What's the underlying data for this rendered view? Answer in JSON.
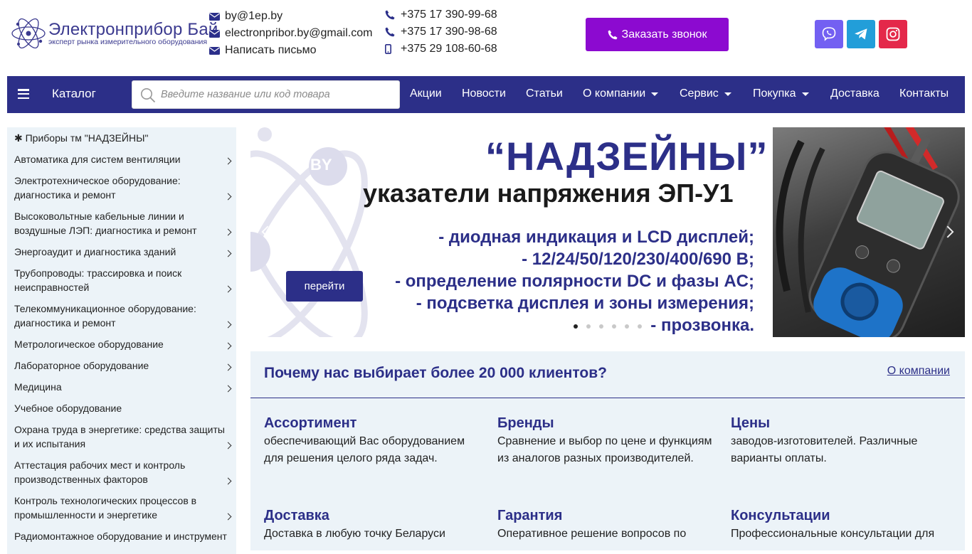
{
  "logo": {
    "name": "Электронприбор Бай",
    "tagline": "эксперт рынка измерительного оборудования"
  },
  "contacts": {
    "emails": [
      "by@1ep.by",
      "electronpribor.by@gmail.com",
      "Написать письмо"
    ],
    "phones": [
      "+375 17 390-99-68",
      "+375 17 390-98-68",
      "+375 29 108-60-68"
    ]
  },
  "callback_label": "Заказать звонок",
  "colors": {
    "brand": "#2c2f88",
    "callback": "#8c0ad0",
    "viber": "#7360f2",
    "telegram": "#229ed9",
    "instagram": "#e4284a",
    "panel": "#ecf3f8"
  },
  "nav": {
    "catalog": "Каталог",
    "search_placeholder": "Введите название или код товара",
    "items": [
      "Акции",
      "Новости",
      "Статьи",
      "О компании",
      "Сервис",
      "Покупка",
      "Доставка",
      "Контакты"
    ]
  },
  "sidebar": {
    "items": [
      {
        "label": "✱  Приборы тм \"НАДЗЕЙНЫ\""
      },
      {
        "label": "Автоматика для систем вентиляции"
      },
      {
        "label": "Электротехническое оборудование: диагностика и ремонт"
      },
      {
        "label": "Высоковольтные кабельные линии и воздушные ЛЭП: диагностика и ремонт"
      },
      {
        "label": "Энергоаудит и диагностика зданий"
      },
      {
        "label": "Трубопроводы: трассировка и поиск неисправностей"
      },
      {
        "label": "Телекоммуникационное оборудование: диагностика и ремонт"
      },
      {
        "label": "Метрологическое оборудование"
      },
      {
        "label": "Лабораторное оборудование"
      },
      {
        "label": "Медицина"
      },
      {
        "label": "Учебное оборудование"
      },
      {
        "label": "Охрана труда в энергетике: средства защиты и их испытания"
      },
      {
        "label": "Аттестация рабочих мест и контроль производственных факторов"
      },
      {
        "label": "Контроль технологических процессов в промышленности и энергетике"
      },
      {
        "label": "Радиомонтажное оборудование и инструмент"
      }
    ]
  },
  "banner": {
    "badge": "BY",
    "title": "“НАДЗЕЙНЫ”",
    "subtitle": "указатели напряжения ЭП-У1",
    "lines": [
      "- диодная индикация и LCD дисплей;",
      "- 12/24/50/120/230/400/690 В;",
      "- определение полярности DC и фазы AC;",
      "- подсветка дисплея и зоны измерения;",
      "- прозвонка."
    ],
    "button": "перейти",
    "slides": 6,
    "active_slide": 1
  },
  "why": {
    "title": "Почему нас выбирает более 20 000 клиентов?",
    "link": "О компании",
    "features": [
      {
        "title": "Ассортимент",
        "text": "обеспечивающий Вас оборудованием для решения целого ряда задач."
      },
      {
        "title": "Бренды",
        "text": "Сравнение и выбор по цене и функциям из аналогов разных производителей."
      },
      {
        "title": "Цены",
        "text": "заводов-изготовителей. Различные варианты оплаты."
      },
      {
        "title": "Доставка",
        "text": "Доставка в любую точку Беларуси"
      },
      {
        "title": "Гарантия",
        "text": "Оперативное решение вопросов по"
      },
      {
        "title": "Консультации",
        "text": "Профессиональные консультации для"
      }
    ]
  }
}
